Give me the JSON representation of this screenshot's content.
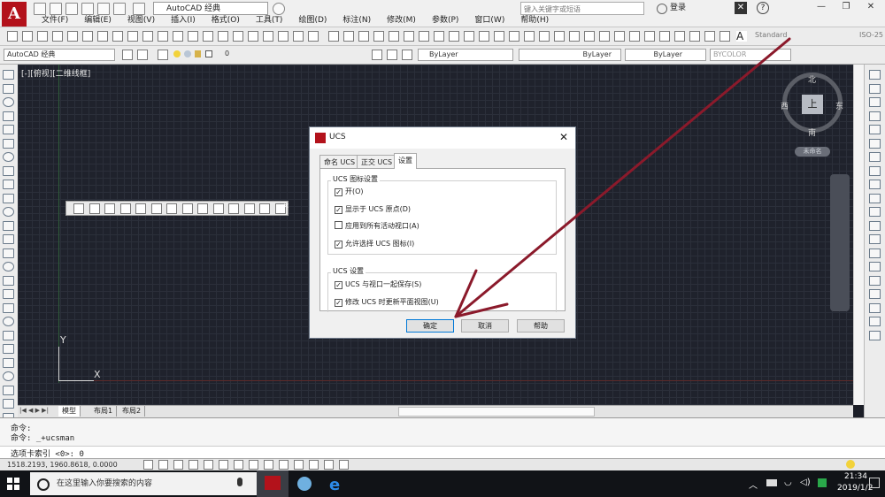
{
  "app": {
    "logo": "A",
    "workspace": "AutoCAD 经典",
    "search_placeholder": "键入关键字或短语",
    "login": "登录",
    "menus": [
      "文件(F)",
      "编辑(E)",
      "视图(V)",
      "插入(I)",
      "格式(O)",
      "工具(T)",
      "绘图(D)",
      "标注(N)",
      "修改(M)",
      "参数(P)",
      "窗口(W)",
      "帮助(H)"
    ]
  },
  "toolbar": {
    "text_style": "Standard",
    "dim_style": "ISO-25",
    "workspace_combo": "AutoCAD 经典",
    "layer": "0",
    "color": "ByLayer",
    "linetype": "ByLayer",
    "lineweight": "ByLayer",
    "plotstyle": "BYCOLOR"
  },
  "viewport": {
    "label": "[-][俯视][二维线框]",
    "y_axis": "Y",
    "x_axis": "X",
    "cube_face": "上",
    "north": "北",
    "south": "南",
    "east": "东",
    "west": "西",
    "wcs": "未命名"
  },
  "tabs": [
    "模型",
    "布局1",
    "布局2"
  ],
  "command": {
    "line1": "命令:",
    "line2": "命令: _+ucsman",
    "prompt": "选项卡索引 <0>: 0"
  },
  "status": {
    "coords": "1518.2193, 1960.8618, 0.0000"
  },
  "taskbar": {
    "search": "在这里输入你要搜索的内容",
    "time": "21:34",
    "date": "2019/1/2"
  },
  "dialog": {
    "title": "UCS",
    "tabs": [
      "命名 UCS",
      "正交 UCS",
      "设置"
    ],
    "group1_title": "UCS 图标设置",
    "group1_items": [
      {
        "label": "开(O)",
        "checked": true
      },
      {
        "label": "显示于 UCS 原点(D)",
        "checked": true
      },
      {
        "label": "应用到所有活动视口(A)",
        "checked": false
      },
      {
        "label": "允许选择 UCS 图标(I)",
        "checked": true
      }
    ],
    "group2_title": "UCS 设置",
    "group2_items": [
      {
        "label": "UCS 与视口一起保存(S)",
        "checked": true
      },
      {
        "label": "修改 UCS 时更新平面视图(U)",
        "checked": true
      }
    ],
    "ok": "确定",
    "cancel": "取消",
    "help": "帮助"
  },
  "colors": {
    "annotation_arrow": "#8b1a2b",
    "canvas": "#1f222c"
  }
}
